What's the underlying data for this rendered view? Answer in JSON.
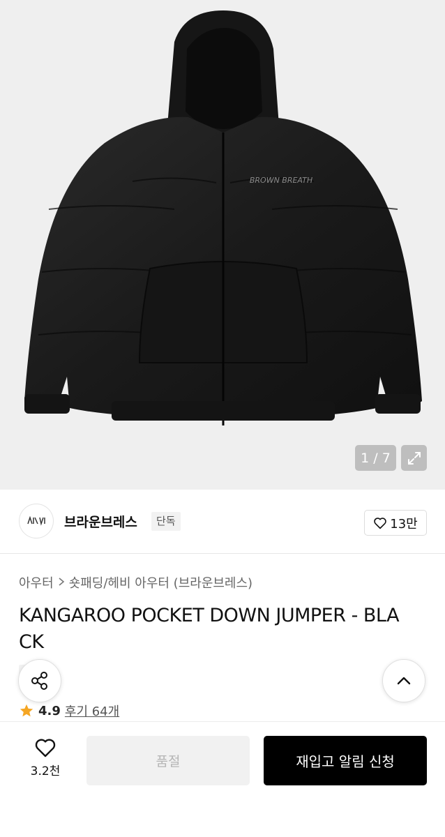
{
  "image": {
    "pager": "1 / 7",
    "logo_text": "BROWN BREATH"
  },
  "brand": {
    "name": "브라운브레스",
    "badge": "단독",
    "like_count": "13만"
  },
  "product": {
    "breadcrumb": [
      "아우터",
      "숏패딩/헤비 아우터 (브라운브레스)"
    ],
    "title_line1": "KANGAROO POCKET DOWN JUMPER - BLA",
    "title_line2": "CK",
    "badge": "단독",
    "rating": "4.9",
    "reviews": "후기 64개"
  },
  "bottom_bar": {
    "wish_count": "3.2천",
    "soldout_label": "품절",
    "restock_label": "재입고 알림 신청"
  },
  "icons": {
    "zoom": "expand-icon",
    "heart": "heart-icon",
    "share": "share-icon",
    "up": "chevron-up-icon",
    "star": "star-icon"
  },
  "colors": {
    "star": "#f5a623",
    "primary_button": "#000000",
    "disabled_button": "#f1f1f1"
  }
}
